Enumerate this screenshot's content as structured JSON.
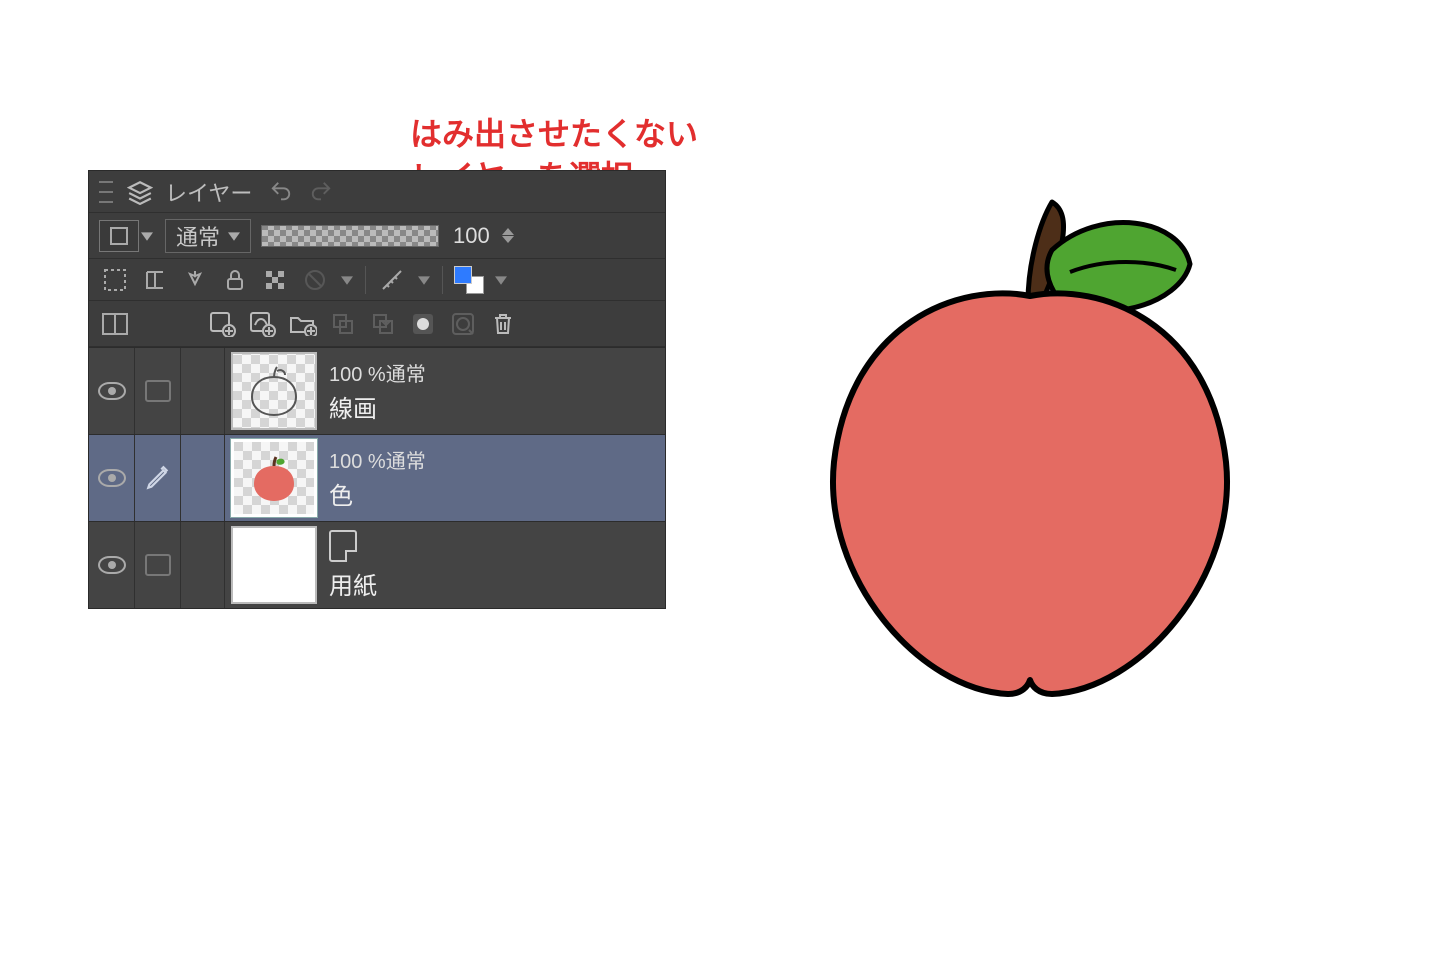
{
  "annotation": {
    "line1": "はみ出させたくない",
    "line2": "レイヤーを選択"
  },
  "palette": {
    "title": "レイヤー"
  },
  "blend": {
    "mode": "通常",
    "opacity_value": "100"
  },
  "layers": [
    {
      "opacity_label": "100 %通常",
      "name": "線画",
      "selected": false,
      "kind": "lineart"
    },
    {
      "opacity_label": "100 %通常",
      "name": "色",
      "selected": true,
      "kind": "color"
    },
    {
      "opacity_label": "",
      "name": "用紙",
      "selected": false,
      "kind": "paper"
    }
  ]
}
